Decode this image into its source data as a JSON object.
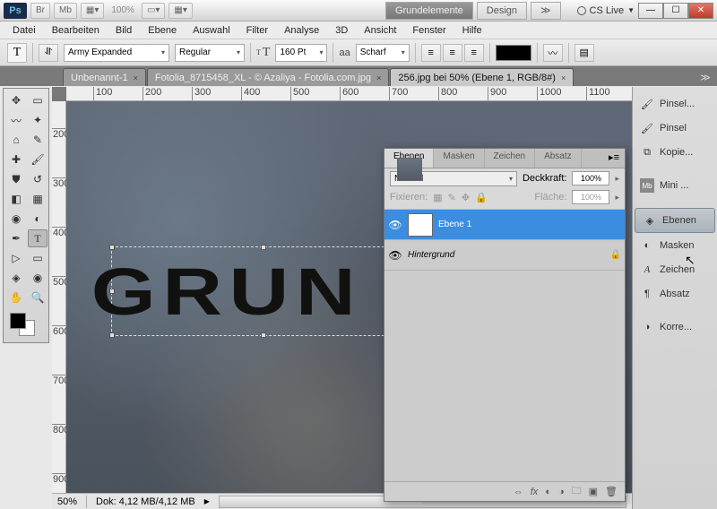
{
  "titlebar": {
    "app_badge": "Ps",
    "zoom_percent": "100%",
    "workspace_active": "Grundelemente",
    "workspace_other": "Design",
    "cs_live": "CS Live"
  },
  "menu": [
    "Datei",
    "Bearbeiten",
    "Bild",
    "Ebene",
    "Auswahl",
    "Filter",
    "Analyse",
    "3D",
    "Ansicht",
    "Fenster",
    "Hilfe"
  ],
  "options": {
    "font_family": "Army Expanded",
    "font_style": "Regular",
    "font_size": "160 Pt",
    "aa_label": "Scharf",
    "aa_prefix": "aa"
  },
  "doc_tabs": [
    {
      "label": "Unbenannt-1",
      "active": false
    },
    {
      "label": "Fotolia_8715458_XL - © Azaliya - Fotolia.com.jpg",
      "active": false
    },
    {
      "label": "256.jpg bei 50% (Ebene 1, RGB/8#)",
      "active": true
    }
  ],
  "ruler_h": [
    "100",
    "200",
    "300",
    "400",
    "500",
    "600",
    "700",
    "800",
    "900",
    "1000",
    "1100"
  ],
  "ruler_v": [
    "200",
    "300",
    "400",
    "500",
    "600",
    "700",
    "800",
    "900"
  ],
  "canvas_text": "GRUN",
  "status": {
    "zoom": "50%",
    "doc_size": "Dok: 4,12 MB/4,12 MB"
  },
  "dock_items": [
    {
      "icon": "brush",
      "label": "Pinsel..."
    },
    {
      "icon": "brush",
      "label": "Pinsel"
    },
    {
      "icon": "history",
      "label": "Kopie..."
    },
    {
      "sep": true
    },
    {
      "icon": "mb",
      "label": "Mini ..."
    },
    {
      "sep": true
    },
    {
      "icon": "layers",
      "label": "Ebenen",
      "active": true
    },
    {
      "icon": "mask",
      "label": "Masken"
    },
    {
      "icon": "char",
      "label": "Zeichen"
    },
    {
      "icon": "para",
      "label": "Absatz"
    },
    {
      "sep": true
    },
    {
      "icon": "adjust",
      "label": "Korre..."
    }
  ],
  "layers_panel": {
    "tabs": [
      "Ebenen",
      "Masken",
      "Zeichen",
      "Absatz"
    ],
    "blend_mode": "Normal",
    "opacity_label": "Deckkraft:",
    "opacity_value": "100%",
    "lock_label": "Fixieren:",
    "fill_label": "Fläche:",
    "fill_value": "100%",
    "layers": [
      {
        "name": "Ebene 1",
        "type": "text",
        "selected": true,
        "visible": true,
        "locked": false
      },
      {
        "name": "Hintergrund",
        "type": "bg",
        "selected": false,
        "visible": true,
        "locked": true
      }
    ]
  }
}
